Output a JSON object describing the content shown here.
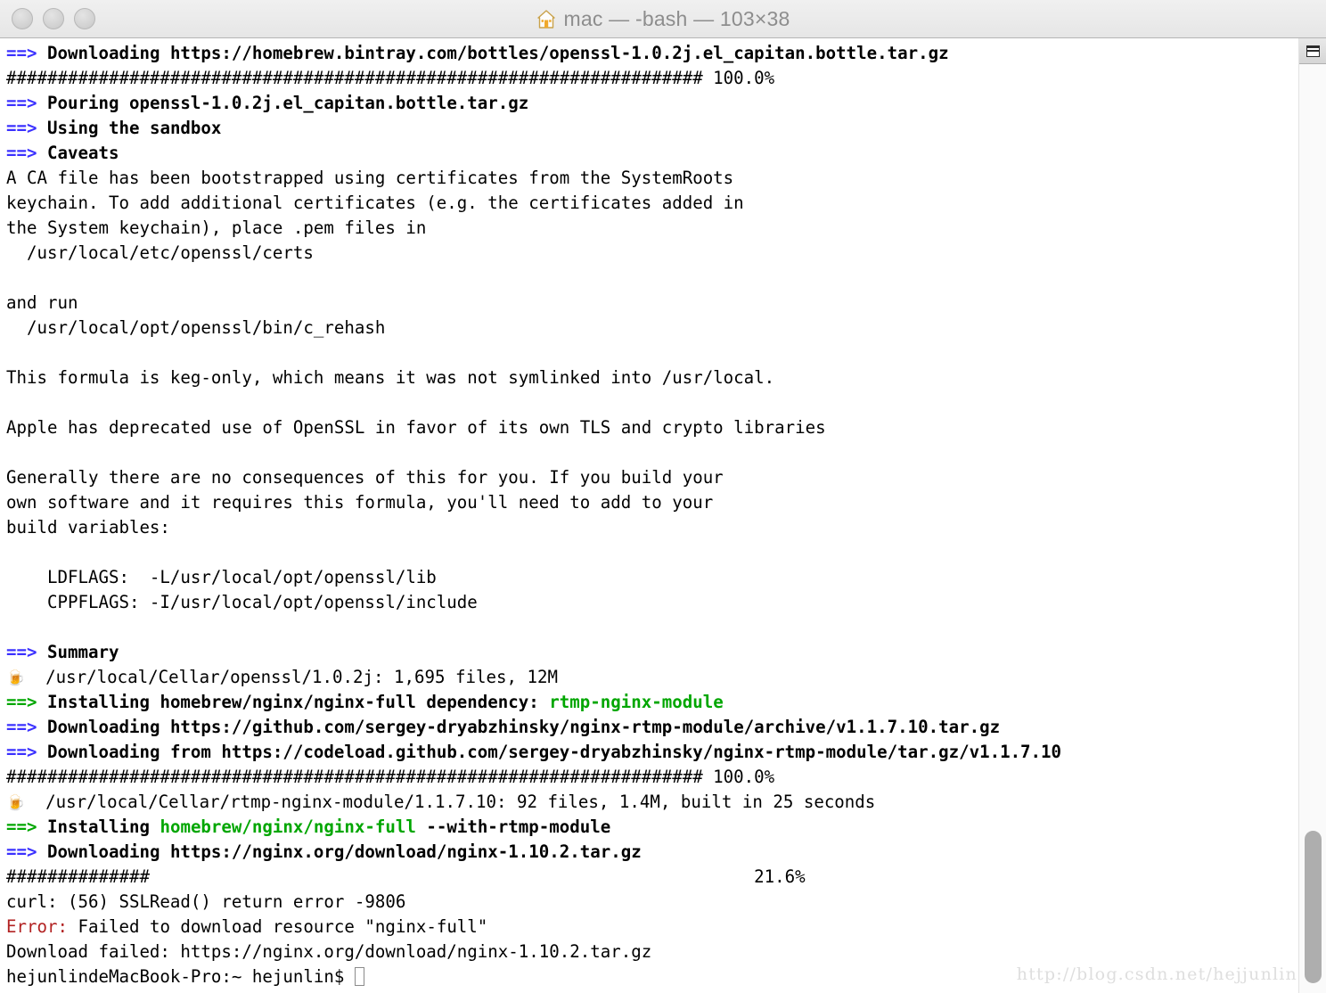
{
  "window": {
    "title": "mac — -bash — 103×38",
    "home_icon": "home-icon",
    "traffic_lights": [
      {
        "name": "close-button",
        "label": "Close"
      },
      {
        "name": "minimize-button",
        "label": "Minimize"
      },
      {
        "name": "zoom-button",
        "label": "Zoom"
      }
    ]
  },
  "colors": {
    "arrow_blue": "#3b31ff",
    "arrow_green": "#00a600",
    "error_red": "#b22222",
    "text": "#000000",
    "background": "#ffffff",
    "titlebar": "#e9e9e9",
    "title_text": "#8d8d8d",
    "scrollbar_thumb": "#aeaeae",
    "watermark": "#dedede"
  },
  "scrollbar": {
    "marks_button": "terminal-marks-button",
    "thumb_top_pct": 83,
    "thumb_height_pct": 16
  },
  "watermark": "http://blog.csdn.net/hejjunlin",
  "terminal": {
    "columns": 103,
    "rows": 38,
    "prompt": "hejunlindeMacBook-Pro:~ hejunlin$ ",
    "hash_bar_full": "####################################################################################",
    "hash_bar_partial": "##############",
    "lines": [
      {
        "id": "line-1",
        "parts": [
          {
            "t": "arrow-blue",
            "s": "==>"
          },
          {
            "t": "bold",
            "s": " Downloading https://homebrew.bintray.com/bottles/openssl-1.0.2j.el_capitan.bottle.tar.gz"
          }
        ]
      },
      {
        "id": "line-2",
        "parts": [
          {
            "t": "plain",
            "s": "#################################################################### 100.0%"
          }
        ]
      },
      {
        "id": "line-3",
        "parts": [
          {
            "t": "arrow-blue",
            "s": "==>"
          },
          {
            "t": "bold",
            "s": " Pouring openssl-1.0.2j.el_capitan.bottle.tar.gz"
          }
        ]
      },
      {
        "id": "line-4",
        "parts": [
          {
            "t": "arrow-blue",
            "s": "==>"
          },
          {
            "t": "bold",
            "s": " Using the sandbox"
          }
        ]
      },
      {
        "id": "line-5",
        "parts": [
          {
            "t": "arrow-blue",
            "s": "==>"
          },
          {
            "t": "bold",
            "s": " Caveats"
          }
        ]
      },
      {
        "id": "line-6",
        "parts": [
          {
            "t": "plain",
            "s": "A CA file has been bootstrapped using certificates from the SystemRoots"
          }
        ]
      },
      {
        "id": "line-7",
        "parts": [
          {
            "t": "plain",
            "s": "keychain. To add additional certificates (e.g. the certificates added in"
          }
        ]
      },
      {
        "id": "line-8",
        "parts": [
          {
            "t": "plain",
            "s": "the System keychain), place .pem files in"
          }
        ]
      },
      {
        "id": "line-9",
        "parts": [
          {
            "t": "plain",
            "s": "  /usr/local/etc/openssl/certs"
          }
        ]
      },
      {
        "id": "line-10",
        "parts": [
          {
            "t": "plain",
            "s": ""
          }
        ]
      },
      {
        "id": "line-11",
        "parts": [
          {
            "t": "plain",
            "s": "and run"
          }
        ]
      },
      {
        "id": "line-12",
        "parts": [
          {
            "t": "plain",
            "s": "  /usr/local/opt/openssl/bin/c_rehash"
          }
        ]
      },
      {
        "id": "line-13",
        "parts": [
          {
            "t": "plain",
            "s": ""
          }
        ]
      },
      {
        "id": "line-14",
        "parts": [
          {
            "t": "plain",
            "s": "This formula is keg-only, which means it was not symlinked into /usr/local."
          }
        ]
      },
      {
        "id": "line-15",
        "parts": [
          {
            "t": "plain",
            "s": ""
          }
        ]
      },
      {
        "id": "line-16",
        "parts": [
          {
            "t": "plain",
            "s": "Apple has deprecated use of OpenSSL in favor of its own TLS and crypto libraries"
          }
        ]
      },
      {
        "id": "line-17",
        "parts": [
          {
            "t": "plain",
            "s": ""
          }
        ]
      },
      {
        "id": "line-18",
        "parts": [
          {
            "t": "plain",
            "s": "Generally there are no consequences of this for you. If you build your"
          }
        ]
      },
      {
        "id": "line-19",
        "parts": [
          {
            "t": "plain",
            "s": "own software and it requires this formula, you'll need to add to your"
          }
        ]
      },
      {
        "id": "line-20",
        "parts": [
          {
            "t": "plain",
            "s": "build variables:"
          }
        ]
      },
      {
        "id": "line-21",
        "parts": [
          {
            "t": "plain",
            "s": ""
          }
        ]
      },
      {
        "id": "line-22",
        "parts": [
          {
            "t": "plain",
            "s": "    LDFLAGS:  -L/usr/local/opt/openssl/lib"
          }
        ]
      },
      {
        "id": "line-23",
        "parts": [
          {
            "t": "plain",
            "s": "    CPPFLAGS: -I/usr/local/opt/openssl/include"
          }
        ]
      },
      {
        "id": "line-24",
        "parts": [
          {
            "t": "plain",
            "s": ""
          }
        ]
      },
      {
        "id": "line-25",
        "parts": [
          {
            "t": "arrow-blue",
            "s": "==>"
          },
          {
            "t": "bold",
            "s": " Summary"
          }
        ]
      },
      {
        "id": "line-26",
        "parts": [
          {
            "t": "emoji",
            "s": "🍺"
          },
          {
            "t": "plain",
            "s": "  /usr/local/Cellar/openssl/1.0.2j: 1,695 files, 12M"
          }
        ]
      },
      {
        "id": "line-27",
        "parts": [
          {
            "t": "arrow-green",
            "s": "==>"
          },
          {
            "t": "bold",
            "s": " Installing homebrew/nginx/nginx-full dependency: "
          },
          {
            "t": "green",
            "s": "rtmp-nginx-module"
          }
        ]
      },
      {
        "id": "line-28",
        "parts": [
          {
            "t": "arrow-blue",
            "s": "==>"
          },
          {
            "t": "bold",
            "s": " Downloading https://github.com/sergey-dryabzhinsky/nginx-rtmp-module/archive/v1.1.7.10.tar.gz"
          }
        ]
      },
      {
        "id": "line-29",
        "parts": [
          {
            "t": "arrow-blue",
            "s": "==>"
          },
          {
            "t": "bold",
            "s": " Downloading from https://codeload.github.com/sergey-dryabzhinsky/nginx-rtmp-module/tar.gz/v1.1.7.10"
          }
        ]
      },
      {
        "id": "line-30",
        "parts": [
          {
            "t": "plain",
            "s": "#################################################################### 100.0%"
          }
        ]
      },
      {
        "id": "line-31",
        "parts": [
          {
            "t": "emoji",
            "s": "🍺"
          },
          {
            "t": "plain",
            "s": "  /usr/local/Cellar/rtmp-nginx-module/1.1.7.10: 92 files, 1.4M, built in 25 seconds"
          }
        ]
      },
      {
        "id": "line-32",
        "parts": [
          {
            "t": "arrow-green",
            "s": "==>"
          },
          {
            "t": "bold",
            "s": " Installing "
          },
          {
            "t": "green",
            "s": "homebrew/nginx/nginx-full"
          },
          {
            "t": "bold",
            "s": " --with-rtmp-module"
          }
        ]
      },
      {
        "id": "line-33",
        "parts": [
          {
            "t": "arrow-blue",
            "s": "==>"
          },
          {
            "t": "bold",
            "s": " Downloading https://nginx.org/download/nginx-1.10.2.tar.gz"
          }
        ]
      },
      {
        "id": "line-34",
        "parts": [
          {
            "t": "plain",
            "s": "##############                                                           21.6%"
          }
        ]
      },
      {
        "id": "line-35",
        "parts": [
          {
            "t": "plain",
            "s": "curl: (56) SSLRead() return error -9806"
          }
        ]
      },
      {
        "id": "line-36",
        "parts": [
          {
            "t": "error",
            "s": "Error:"
          },
          {
            "t": "plain",
            "s": " Failed to download resource \"nginx-full\""
          }
        ]
      },
      {
        "id": "line-37",
        "parts": [
          {
            "t": "plain",
            "s": "Download failed: https://nginx.org/download/nginx-1.10.2.tar.gz"
          }
        ]
      },
      {
        "id": "line-38",
        "parts": [
          {
            "t": "plain",
            "s": "hejunlindeMacBook-Pro:~ hejunlin$ "
          },
          {
            "t": "cursor",
            "s": ""
          }
        ]
      }
    ]
  }
}
